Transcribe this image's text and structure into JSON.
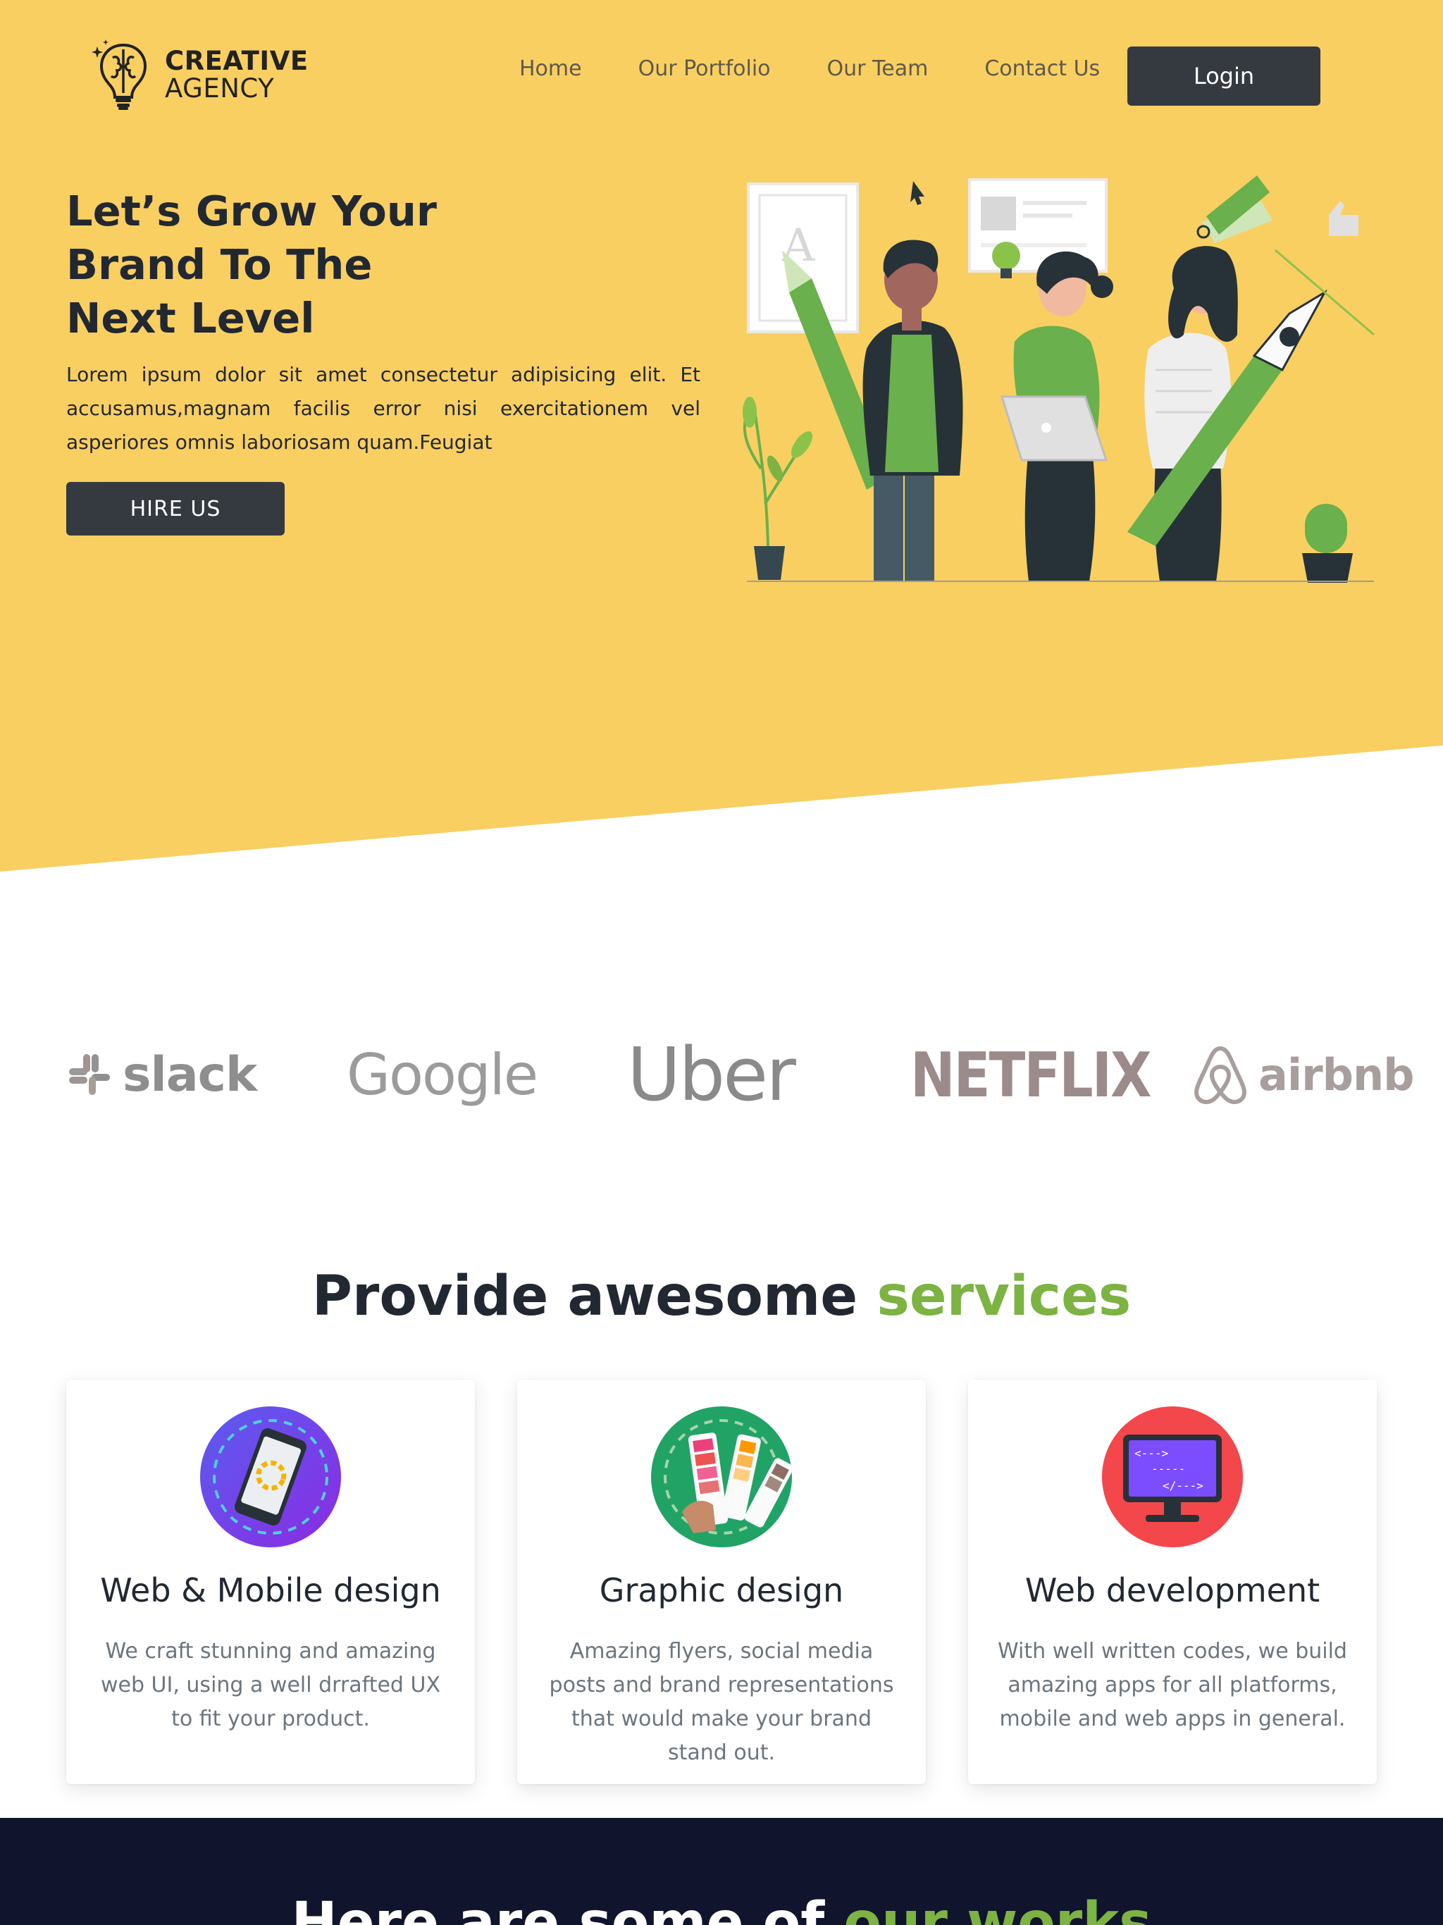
{
  "brand": {
    "line1": "CREATIVE",
    "line2": "AGENCY"
  },
  "nav": {
    "links": [
      "Home",
      "Our Portfolio",
      "Our Team",
      "Contact Us"
    ],
    "login_label": "Login"
  },
  "hero": {
    "title_lines": [
      "Let’s Grow Your",
      "Brand To The",
      "Next Level"
    ],
    "text": "Lorem ipsum dolor sit amet consectetur adipisicing elit. Et accusamus,magnam facilis error nisi exercitationem vel asperiores omnis laboriosam quam.Feugiat",
    "cta_label": "HIRE US"
  },
  "partners": [
    "slack",
    "Google",
    "Uber",
    "NETFLIX",
    "airbnb"
  ],
  "services": {
    "title": "Provide awesome",
    "title_accent": "services",
    "cards": [
      {
        "title": "Web & Mobile design",
        "text": "We craft stunning and amazing web UI, using a well drrafted UX to fit your product.",
        "icon": "mobile-design-icon"
      },
      {
        "title": "Graphic design",
        "text": "Amazing flyers, social media posts and brand representations that would make your brand stand out.",
        "icon": "color-palette-icon"
      },
      {
        "title": "Web development",
        "text": "With well written codes, we build amazing apps for all platforms, mobile and web apps in general.",
        "icon": "code-monitor-icon"
      }
    ]
  },
  "works": {
    "title": "Here are some of",
    "title_accent": "our works"
  },
  "colors": {
    "hero_bg": "#f9cf62",
    "accent_green": "#7cb342",
    "dark_button": "#343a40",
    "dark_section": "#11142d"
  }
}
